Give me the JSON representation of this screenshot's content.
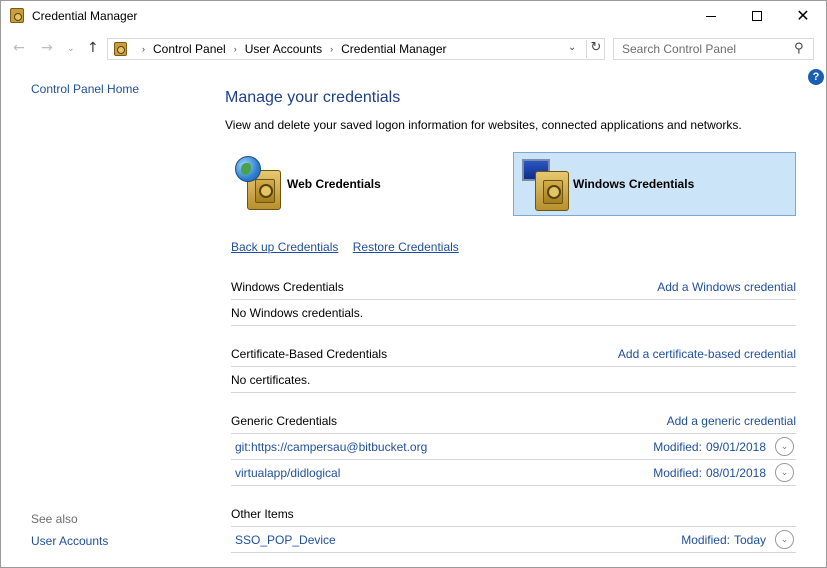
{
  "window": {
    "title": "Credential Manager",
    "minimize_glyph": "",
    "maximize_glyph": "",
    "close_glyph": "✕"
  },
  "nav": {
    "back_glyph": "←",
    "forward_glyph": "→",
    "recent_glyph": "⌄",
    "up_glyph": "↑"
  },
  "address": {
    "crumbs": [
      "Control Panel",
      "User Accounts",
      "Credential Manager"
    ],
    "separator": "›",
    "dropdown_glyph": "⌄",
    "refresh_glyph": "↻"
  },
  "search": {
    "placeholder": "Search Control Panel",
    "icon_glyph": "⚲"
  },
  "help": {
    "glyph": "?"
  },
  "left_pane": {
    "home": "Control Panel Home",
    "see_also": "See also",
    "user_accounts": "User Accounts"
  },
  "main": {
    "heading": "Manage your credentials",
    "subheading": "View and delete your saved logon information for websites, connected applications and networks.",
    "vaults": {
      "web": "Web Credentials",
      "windows": "Windows Credentials"
    },
    "backup": "Back up Credentials",
    "restore": "Restore Credentials"
  },
  "sections": {
    "windows": {
      "title": "Windows Credentials",
      "add": "Add a Windows credential",
      "empty": "No Windows credentials."
    },
    "certificate": {
      "title": "Certificate-Based Credentials",
      "add": "Add a certificate-based credential",
      "empty": "No certificates."
    },
    "generic": {
      "title": "Generic Credentials",
      "add": "Add a generic credential",
      "items": [
        {
          "name": "git:https://campersau@bitbucket.org",
          "modified_label": "Modified:",
          "modified": "09/01/2018"
        },
        {
          "name": "virtualapp/didlogical",
          "modified_label": "Modified:",
          "modified": "08/01/2018"
        }
      ]
    },
    "other": {
      "title": "Other Items",
      "items": [
        {
          "name": "SSO_POP_Device",
          "modified_label": "Modified:",
          "modified": "Today"
        }
      ]
    }
  },
  "expand_glyph": "⌄",
  "colors": {
    "link": "#1f4f9c",
    "heading": "#1e3f88",
    "selected_vault_bg": "#cce4f7",
    "selected_vault_border": "#7ca8d6",
    "help_bg": "#1a5fb4"
  }
}
